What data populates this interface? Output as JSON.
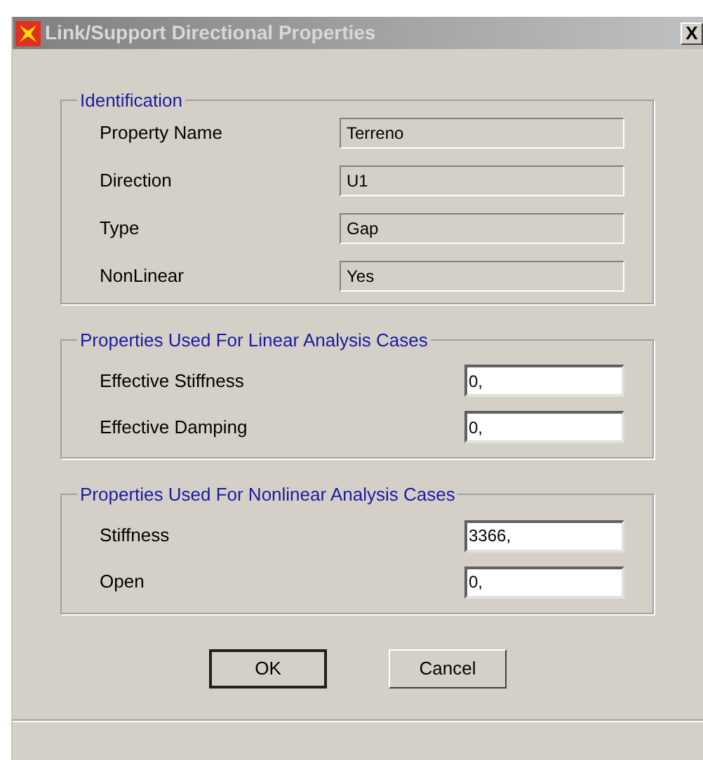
{
  "window": {
    "title": "Link/Support Directional Properties",
    "close": "X"
  },
  "groups": [
    {
      "title": "Identification",
      "kind": "readonly",
      "fields": [
        {
          "label": "Property Name",
          "value": "Terreno"
        },
        {
          "label": "Direction",
          "value": "U1"
        },
        {
          "label": "Type",
          "value": "Gap"
        },
        {
          "label": "NonLinear",
          "value": "Yes"
        }
      ]
    },
    {
      "title": "Properties Used For Linear Analysis Cases",
      "kind": "input",
      "fields": [
        {
          "label": "Effective Stiffness",
          "value": "0,"
        },
        {
          "label": "Effective Damping",
          "value": "0,"
        }
      ]
    },
    {
      "title": "Properties Used For Nonlinear Analysis Cases",
      "kind": "input",
      "fields": [
        {
          "label": "Stiffness",
          "value": "3366,"
        },
        {
          "label": "Open",
          "value": "0,"
        }
      ]
    }
  ],
  "buttons": [
    {
      "label": "OK",
      "default": true
    },
    {
      "label": "Cancel",
      "default": false
    }
  ]
}
